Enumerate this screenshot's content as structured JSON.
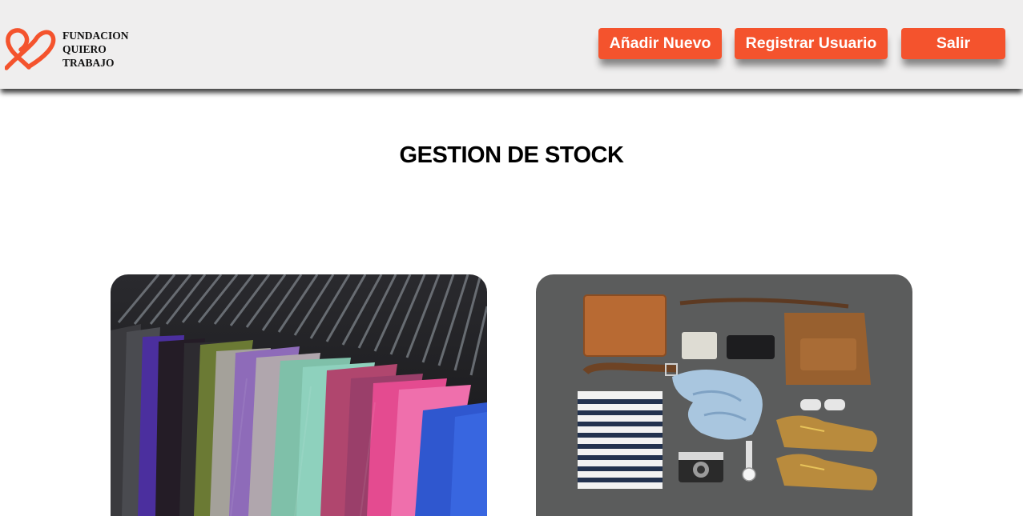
{
  "brand": {
    "line1": "FUNDACION",
    "line2": "QUIERO",
    "line3": "TRABAJO",
    "logo_icon": "heart-ribbon-logo",
    "logo_color": "#f4532d"
  },
  "nav": {
    "add_label": "Añadir Nuevo",
    "register_label": "Registrar Usuario",
    "exit_label": "Salir",
    "button_color": "#f4532d"
  },
  "main": {
    "title": "GESTION DE STOCK"
  },
  "cards": [
    {
      "image": "clothing-rack-photo"
    },
    {
      "image": "accessories-flatlay-photo"
    }
  ]
}
